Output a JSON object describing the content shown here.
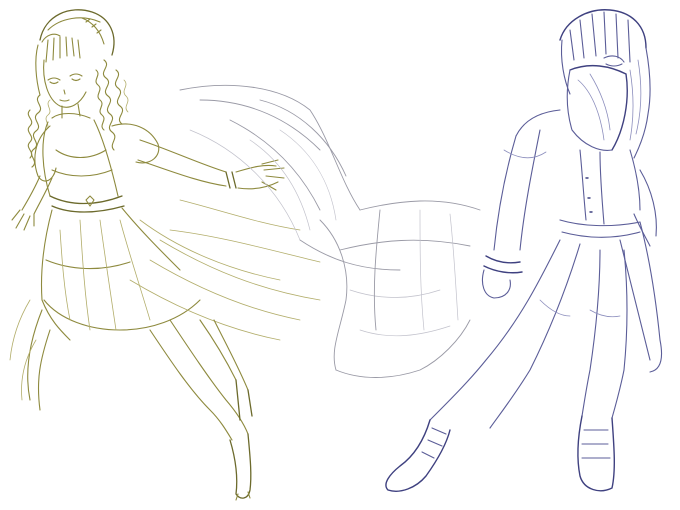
{
  "image": {
    "subject": "",
    "colors": {
      "background": "#ffffff",
      "left_figure_ink": "#8e8a3e",
      "cape_ink": "#9a9aa6",
      "right_figure_ink": "#5b5d98"
    }
  }
}
